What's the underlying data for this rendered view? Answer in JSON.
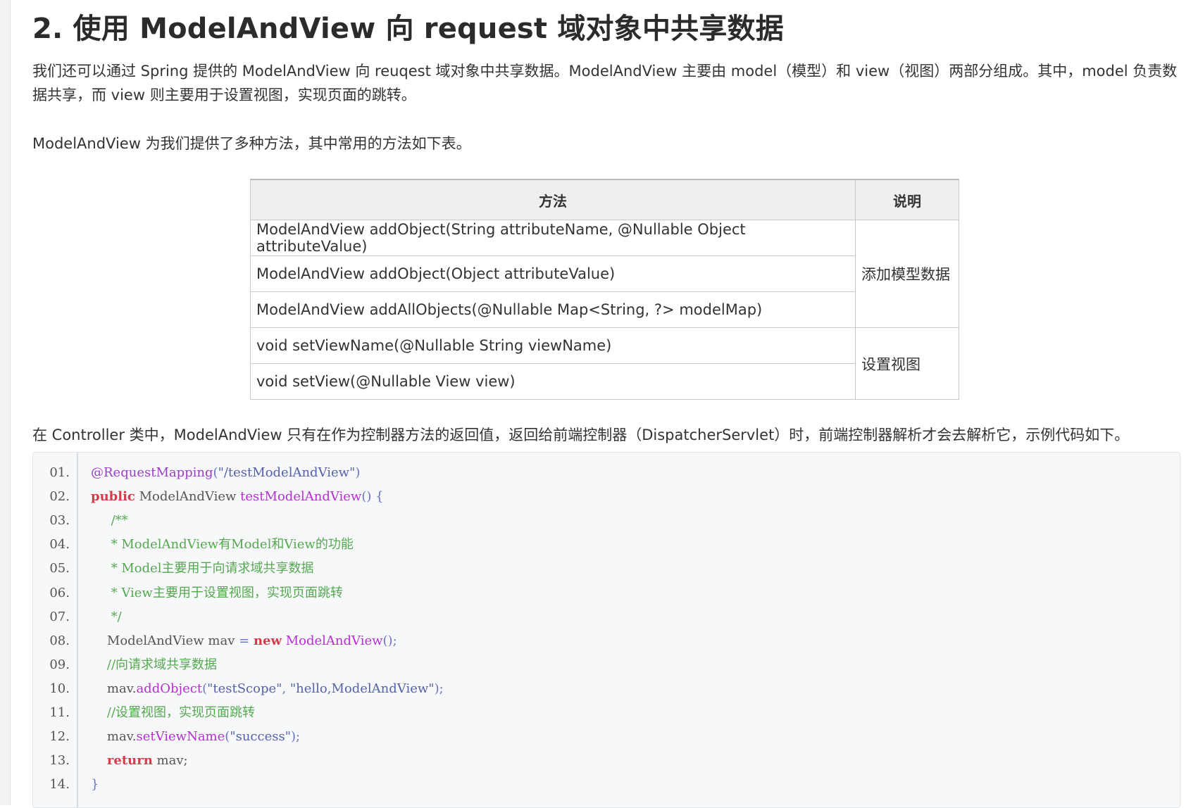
{
  "heading": "2. 使用 ModelAndView 向 request 域对象中共享数据",
  "paragraphs": [
    "我们还可以通过 Spring 提供的 ModelAndView 向 reuqest 域对象中共享数据。ModelAndView 主要由 model（模型）和 view（视图）两部分组成。其中，model 负责数据共享，而 view 则主要用于设置视图，实现页面的跳转。",
    "ModelAndView 为我们提供了多种方法，其中常用的方法如下表。",
    "在 Controller 类中，ModelAndView 只有在作为控制器方法的返回值，返回给前端控制器（DispatcherServlet）时，前端控制器解析才会去解析它，示例代码如下。"
  ],
  "table": {
    "headers": [
      "方法",
      "说明"
    ],
    "rows": [
      " ModelAndView addObject(String attributeName, @Nullable Object attributeValue)",
      "ModelAndView addObject(Object attributeValue)",
      "ModelAndView addAllObjects(@Nullable Map<String, ?> modelMap)",
      "void setViewName(@Nullable String viewName)",
      "void setView(@Nullable View view)"
    ],
    "descriptions": [
      "添加模型数据",
      "设置视图"
    ]
  },
  "code": {
    "line_numbers": [
      "01.",
      "02.",
      "03.",
      "04.",
      "05.",
      "06.",
      "07.",
      "08.",
      "09.",
      "10.",
      "11.",
      "12.",
      "13.",
      "14."
    ],
    "lines": [
      [
        {
          "t": "@RequestMapping",
          "c": "an"
        },
        {
          "t": "(",
          "c": "pn"
        },
        {
          "t": "\"/testModelAndView\"",
          "c": "str"
        },
        {
          "t": ")",
          "c": "pn"
        }
      ],
      [
        {
          "t": "public",
          "c": "kw"
        },
        {
          "t": " ModelAndView ",
          "c": "tx"
        },
        {
          "t": "testModelAndView",
          "c": "fn"
        },
        {
          "t": "() {",
          "c": "pn"
        }
      ],
      [
        {
          "t": "     /**",
          "c": "cm"
        }
      ],
      [
        {
          "t": "     * ModelAndView有Model和View的功能",
          "c": "cm"
        }
      ],
      [
        {
          "t": "     * Model主要用于向请求域共享数据",
          "c": "cm"
        }
      ],
      [
        {
          "t": "     * View主要用于设置视图，实现页面跳转",
          "c": "cm"
        }
      ],
      [
        {
          "t": "     */",
          "c": "cm"
        }
      ],
      [
        {
          "t": "    ModelAndView mav ",
          "c": "tx"
        },
        {
          "t": "= ",
          "c": "pn"
        },
        {
          "t": "new",
          "c": "kw"
        },
        {
          "t": " ",
          "c": "tx"
        },
        {
          "t": "ModelAndView",
          "c": "fn"
        },
        {
          "t": "();",
          "c": "pn"
        }
      ],
      [
        {
          "t": "    //向请求域共享数据",
          "c": "cm"
        }
      ],
      [
        {
          "t": "    mav.",
          "c": "tx"
        },
        {
          "t": "addObject",
          "c": "fn"
        },
        {
          "t": "(",
          "c": "pn"
        },
        {
          "t": "\"testScope\"",
          "c": "str"
        },
        {
          "t": ", ",
          "c": "pn"
        },
        {
          "t": "\"hello,ModelAndView\"",
          "c": "str"
        },
        {
          "t": ");",
          "c": "pn"
        }
      ],
      [
        {
          "t": "    //设置视图，实现页面跳转",
          "c": "cm"
        }
      ],
      [
        {
          "t": "    mav.",
          "c": "tx"
        },
        {
          "t": "setViewName",
          "c": "fn"
        },
        {
          "t": "(",
          "c": "pn"
        },
        {
          "t": "\"success\"",
          "c": "str"
        },
        {
          "t": ");",
          "c": "pn"
        }
      ],
      [
        {
          "t": "    ",
          "c": "tx"
        },
        {
          "t": "return",
          "c": "kw"
        },
        {
          "t": " mav;",
          "c": "tx"
        }
      ],
      [
        {
          "t": "}",
          "c": "pn"
        }
      ]
    ]
  }
}
